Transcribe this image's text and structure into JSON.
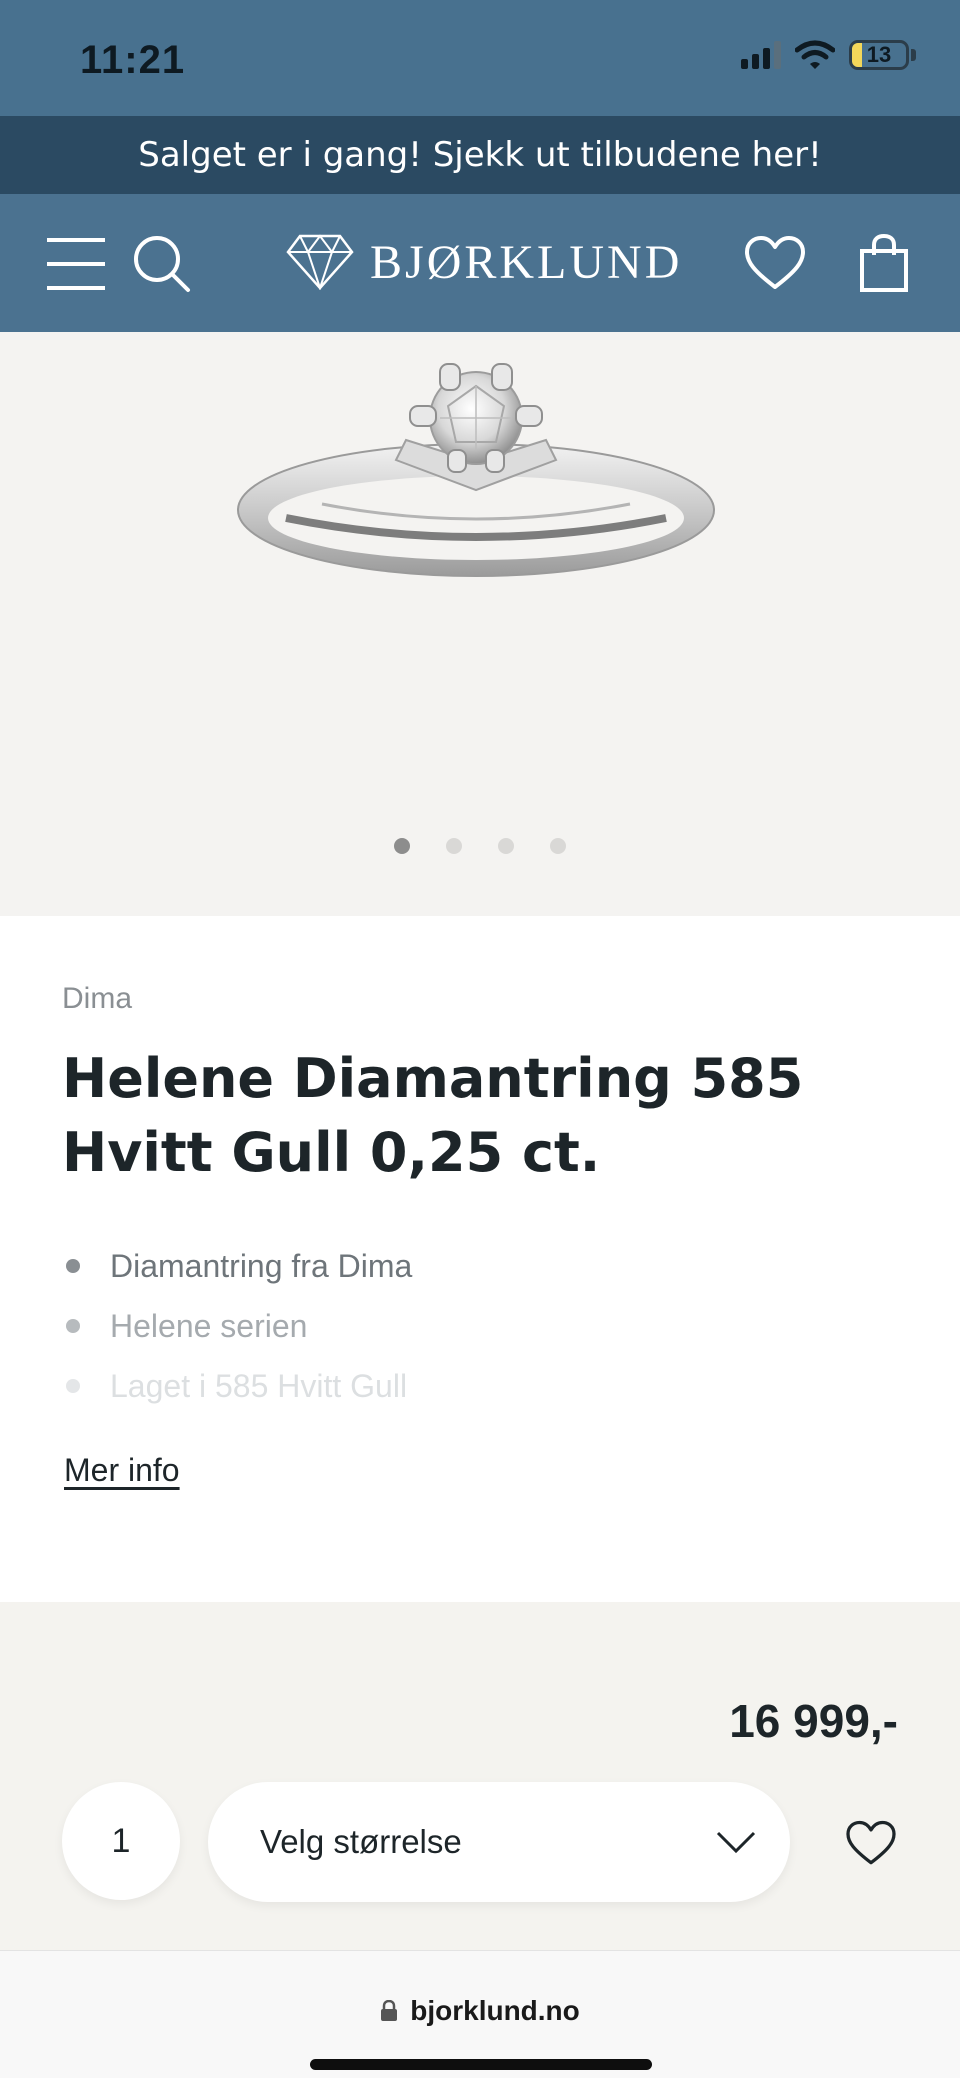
{
  "status_bar": {
    "time": "11:21",
    "battery": "13"
  },
  "promo": {
    "text": "Salget er i gang! Sjekk ut tilbudene her!"
  },
  "header": {
    "logo_text": "BJØRKLUND",
    "menu_icon": "hamburger-icon",
    "search_icon": "search-icon",
    "wishlist_icon": "heart-icon",
    "cart_icon": "bag-icon"
  },
  "gallery": {
    "image": "diamond-ring-white-gold",
    "dot_count": 4,
    "active_index": 0
  },
  "product": {
    "brand": "Dima",
    "title": "Helene Diamantring 585 Hvitt Gull 0,25 ct.",
    "features": [
      "Diamantring fra Dima",
      "Helene serien",
      "Laget i 585 Hvitt Gull"
    ],
    "more_info": "Mer info"
  },
  "purchase": {
    "price": "16 999,-",
    "quantity": "1",
    "size_placeholder": "Velg størrelse"
  },
  "browser": {
    "domain": "bjorklund.no"
  },
  "colors": {
    "header": "#4b7290",
    "promo": "#2b4a62",
    "gallery_bg": "#f4f3f1",
    "purchase_bg": "#f4f3ef"
  }
}
